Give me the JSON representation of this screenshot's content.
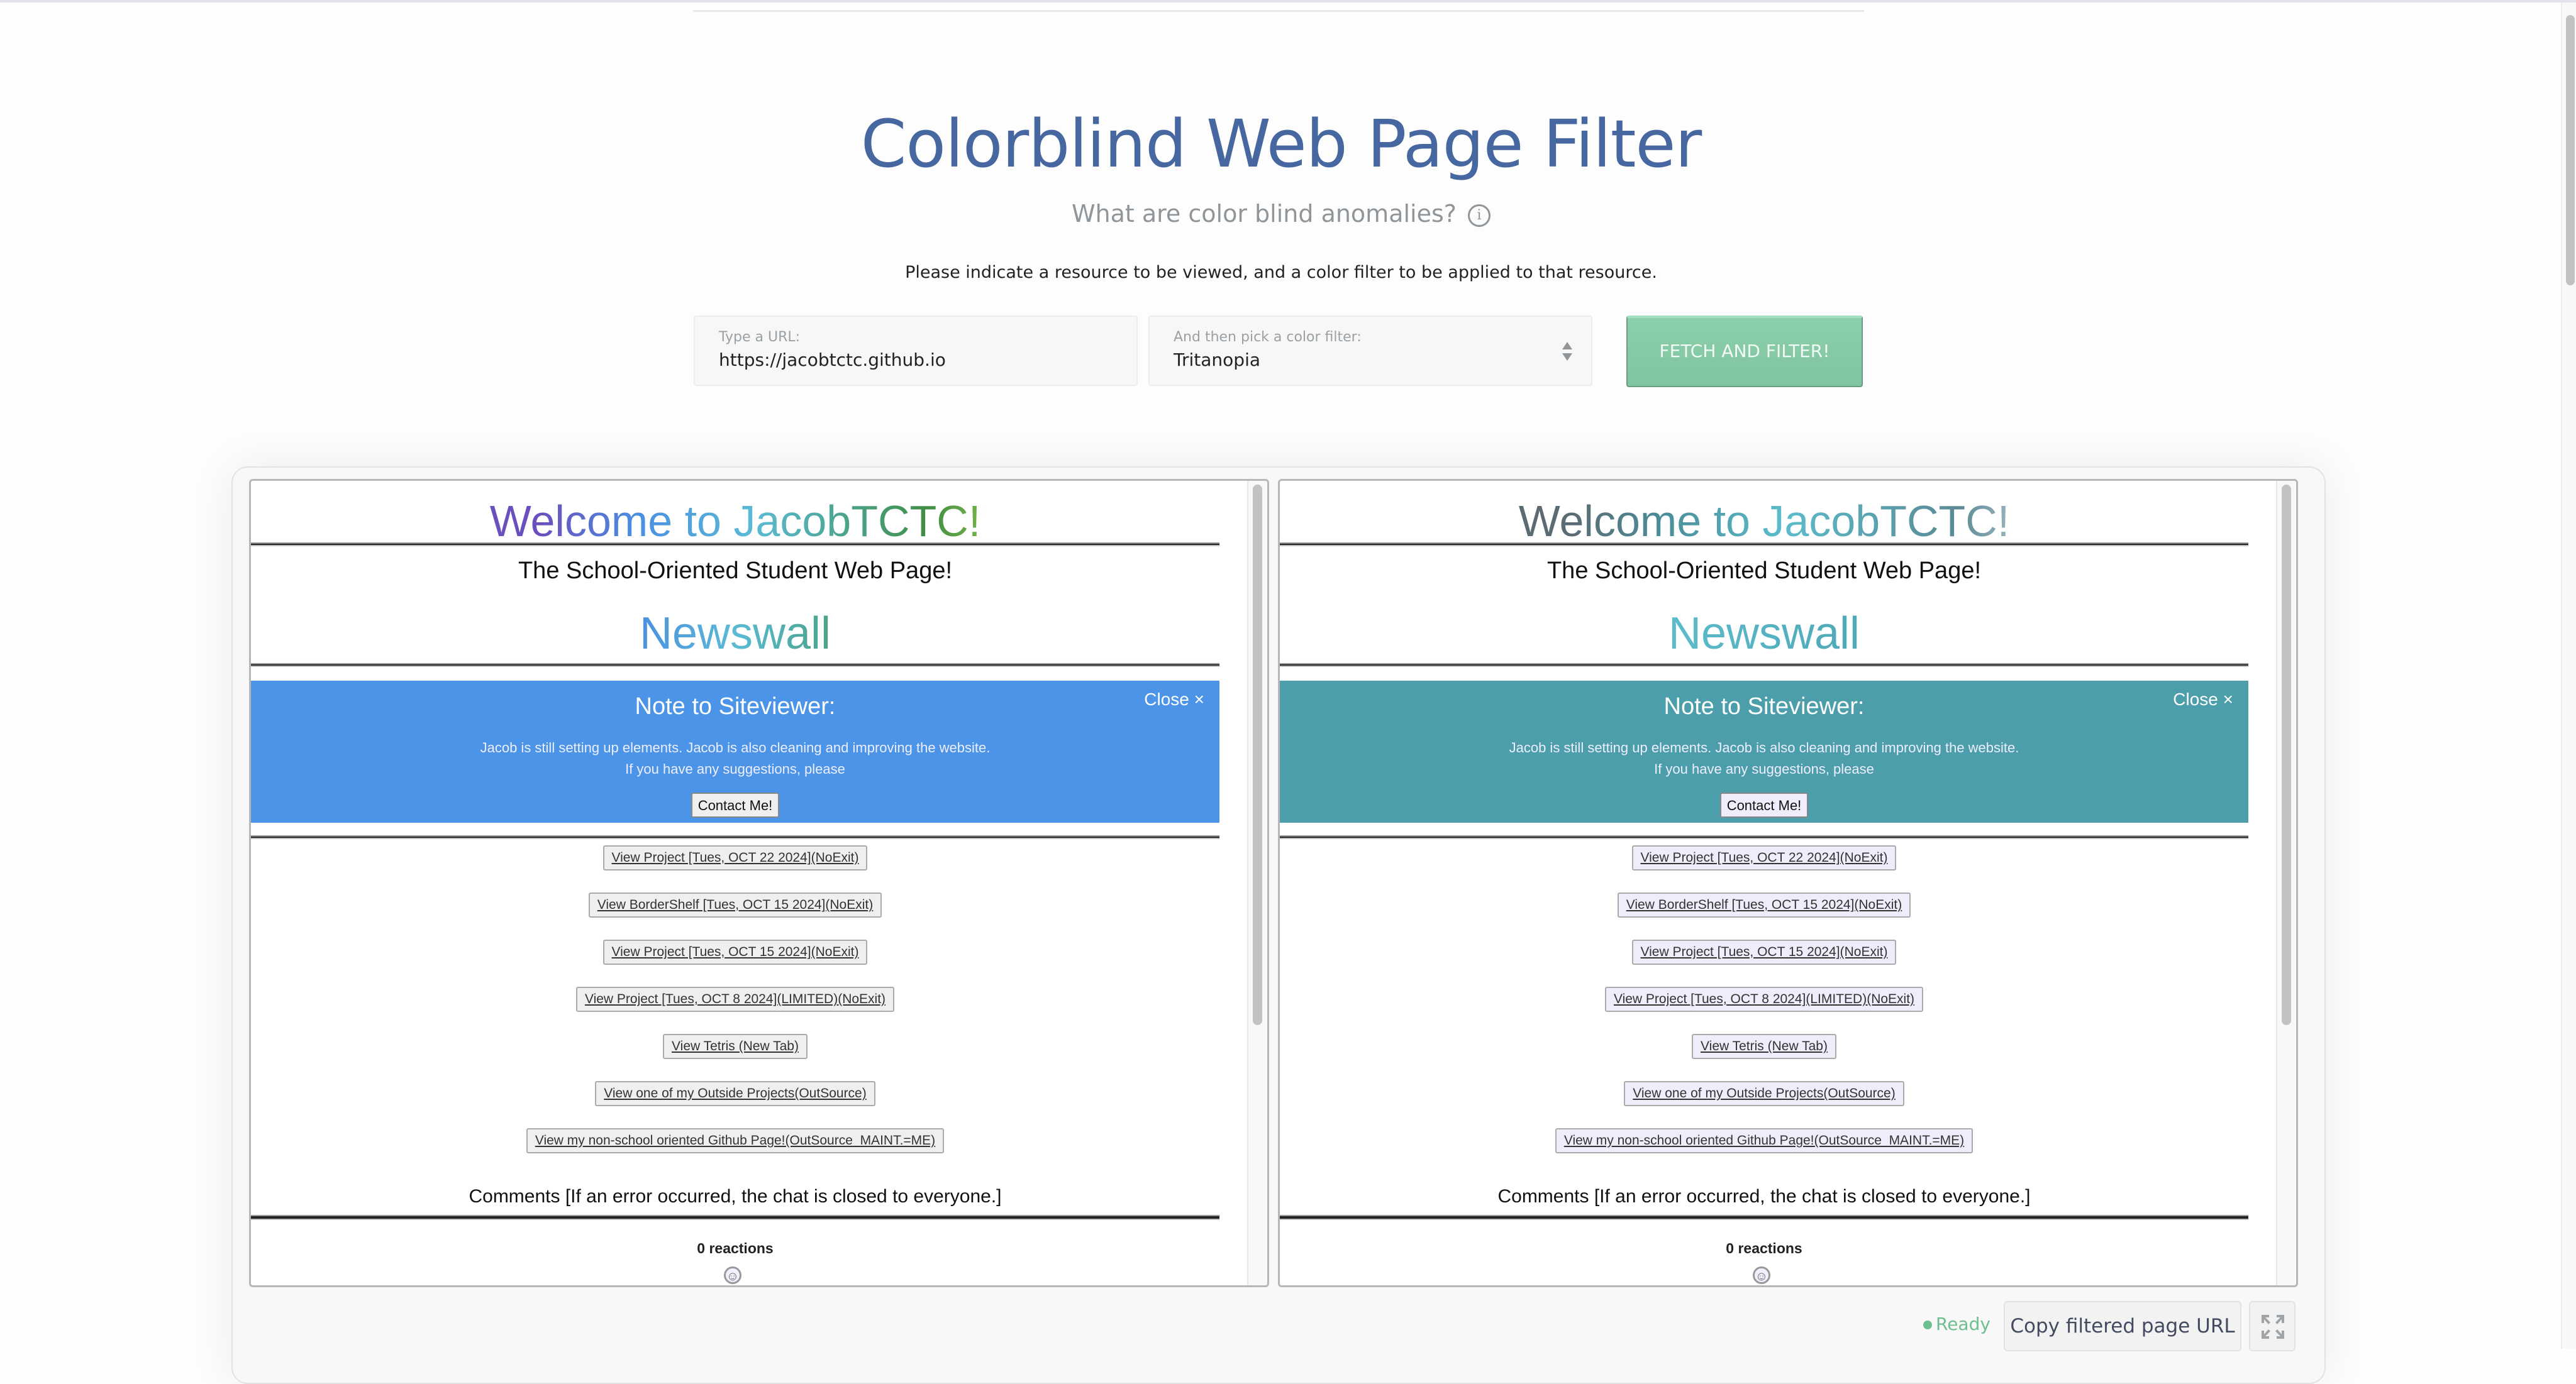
{
  "header": {
    "title": "Colorblind Web Page Filter",
    "subtitle": "What are color blind anomalies?",
    "info_icon": "info-icon",
    "instruction": "Please indicate a resource to be viewed, and a color filter to be applied to that resource."
  },
  "form": {
    "url_label": "Type a URL:",
    "url_value": "https://jacobtctc.github.io",
    "filter_label": "And then pick a color filter:",
    "filter_value": "Tritanopia",
    "fetch_button": "FETCH AND FILTER!"
  },
  "preview": {
    "welcome": "Welcome to JacobTCTC!",
    "tagline": "The School-Oriented Student Web Page!",
    "section": "Newswall",
    "note": {
      "title": "Note to Siteviewer:",
      "close": "Close ×",
      "line1": "Jacob is still setting up elements. Jacob is also cleaning and improving the website.",
      "line2": "If you have any suggestions, please",
      "contact": "Contact Me!"
    },
    "links": [
      "View Project [Tues, OCT 22 2024](NoExit)",
      "View BorderShelf [Tues, OCT 15 2024](NoExit)",
      "View Project [Tues, OCT 15 2024](NoExit)",
      "View Project [Tues, OCT 8 2024](LIMITED)(NoExit)",
      "View Tetris (New Tab)",
      "View one of my Outside Projects(OutSource)",
      "View my non-school oriented Github Page!(OutSource_MAINT.=ME)"
    ],
    "comments": "Comments [If an error occurred, the chat is closed to everyone.]",
    "reactions": "0 reactions",
    "smiley": "☺"
  },
  "colors": {
    "title": "#4667a0",
    "original_note_bg": "#4b94e8",
    "filtered_note_bg": "#4b9eaa",
    "fetch_button": "#86cba6",
    "ready": "#6fbf8e"
  },
  "footer": {
    "status": "Ready",
    "copy_button": "Copy filtered page URL",
    "expand_icon": "expand-icon"
  }
}
